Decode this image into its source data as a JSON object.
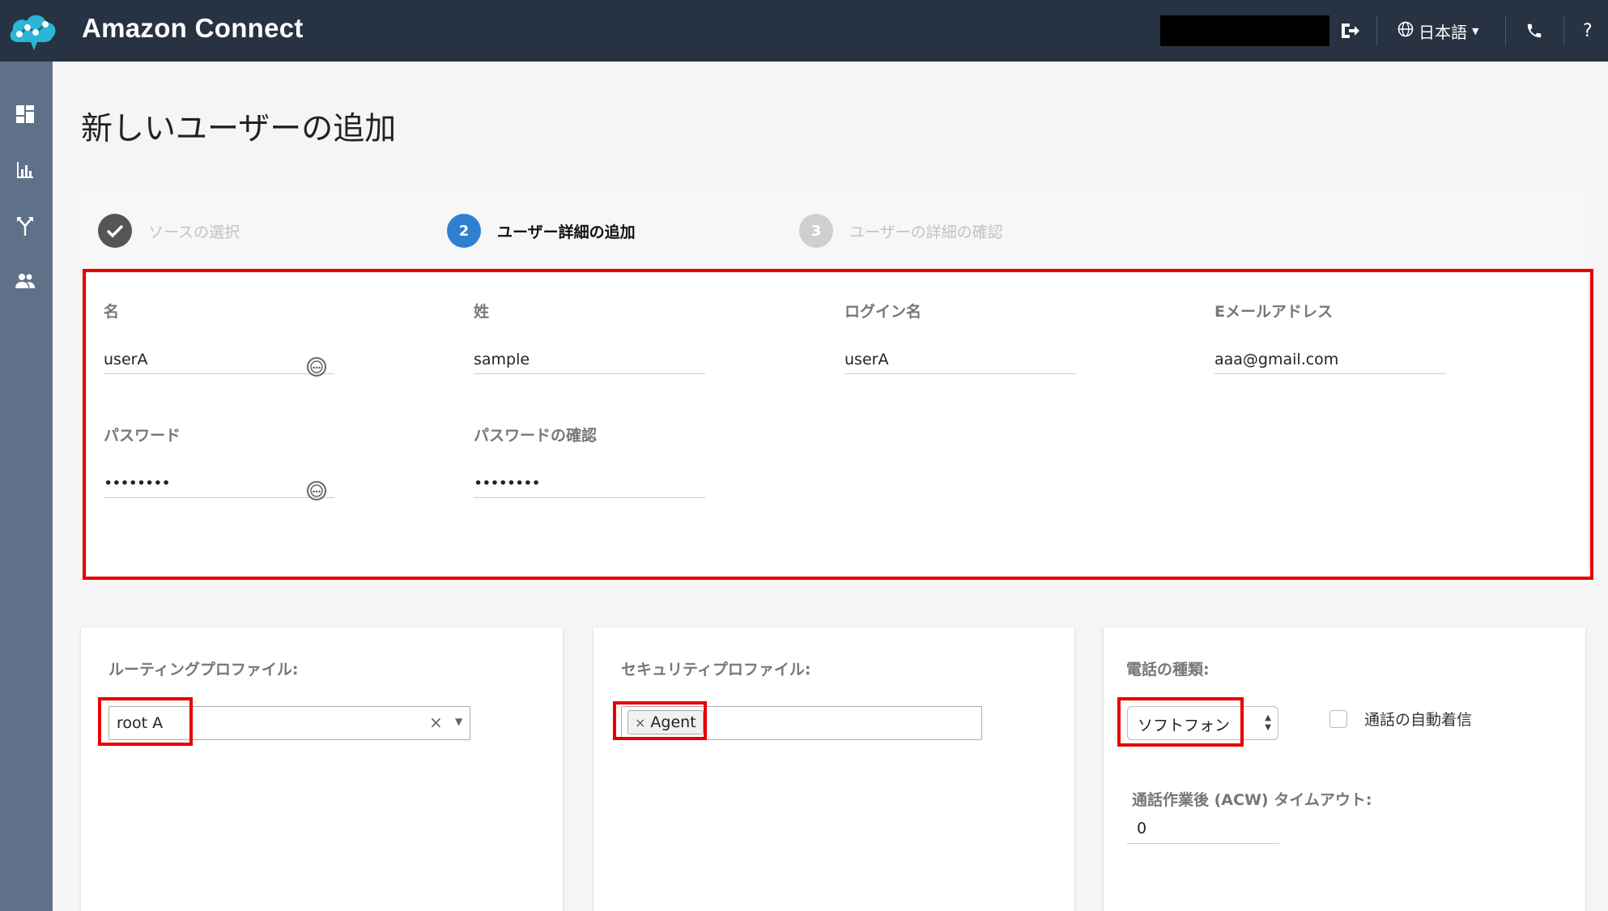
{
  "app": {
    "brand": "Amazon Connect"
  },
  "header": {
    "language": "日本語",
    "help": "?"
  },
  "page": {
    "title": "新しいユーザーの追加"
  },
  "wizard": {
    "steps": [
      {
        "label": "ソースの選択",
        "state": "done"
      },
      {
        "number": "2",
        "label": "ユーザー詳細の追加",
        "state": "active"
      },
      {
        "number": "3",
        "label": "ユーザーの詳細の確認",
        "state": "pending"
      }
    ]
  },
  "form": {
    "first_name": {
      "label": "名",
      "value": "userA"
    },
    "last_name": {
      "label": "姓",
      "value": "sample"
    },
    "login": {
      "label": "ログイン名",
      "value": "userA"
    },
    "email": {
      "label": "Eメールアドレス",
      "value": "aaa@gmail.com"
    },
    "password": {
      "label": "パスワード",
      "value": "••••••••"
    },
    "password_confirm": {
      "label": "パスワードの確認",
      "value": "••••••••"
    }
  },
  "routing": {
    "label": "ルーティングプロファイル:",
    "value": "root A"
  },
  "security": {
    "label": "セキュリティプロファイル:",
    "tag": "Agent"
  },
  "phone": {
    "label": "電話の種類:",
    "value": "ソフトフォン",
    "auto_accept_label": "通話の自動着信",
    "auto_accept_checked": false,
    "acw_label": "通話作業後 (ACW) タイムアウト:",
    "acw_value": "0"
  },
  "colors": {
    "topbar": "#273342",
    "sidebar": "#5e7189",
    "accent": "#2f80d1",
    "highlight": "#e60000"
  }
}
